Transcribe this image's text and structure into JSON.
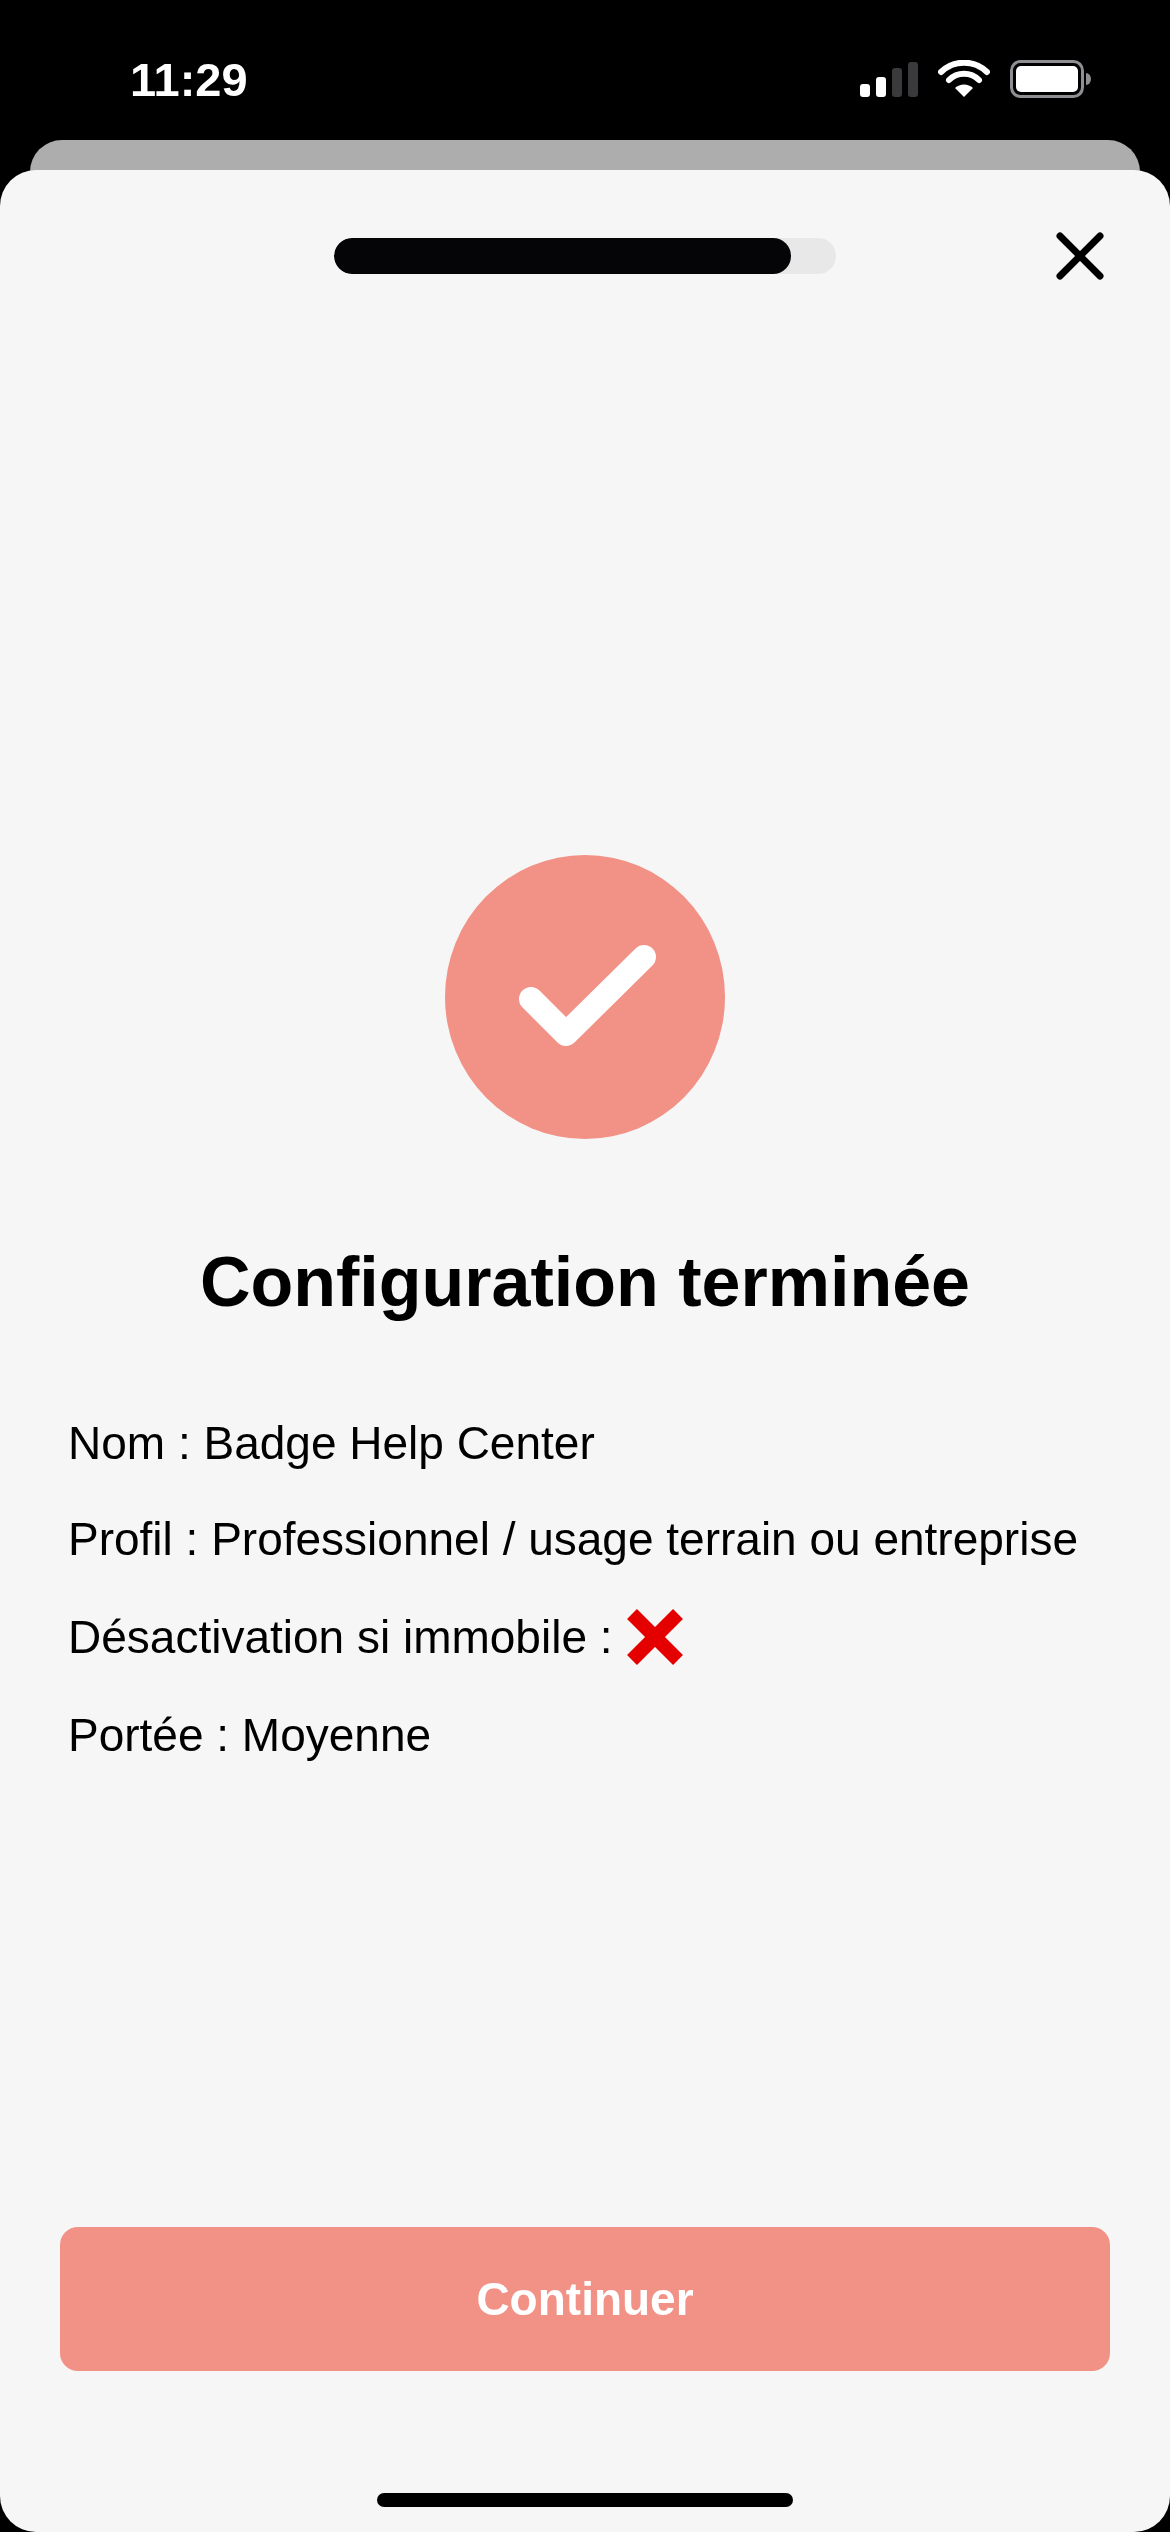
{
  "status_bar": {
    "time": "11:29"
  },
  "progress": {
    "level": 0.91
  },
  "title": "Configuration terminée",
  "details": [
    {
      "kind": "text",
      "text": "Nom : Badge Help Center"
    },
    {
      "kind": "text",
      "text": "Profil : Professionnel / usage terrain ou entreprise"
    },
    {
      "kind": "flag",
      "text": "Désactivation si immobile :",
      "enabled": false
    },
    {
      "kind": "text",
      "text": "Portée : Moyenne"
    }
  ],
  "primary_button": {
    "label": "Continuer"
  }
}
